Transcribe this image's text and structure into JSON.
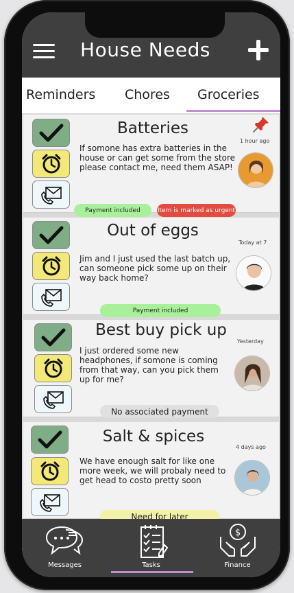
{
  "header": {
    "title": "House Needs"
  },
  "tabs": [
    {
      "label": "Reminders"
    },
    {
      "label": "Chores"
    },
    {
      "label": "Groceries",
      "active": true
    }
  ],
  "cards": [
    {
      "title": "Batteries",
      "description": "If somone has extra batteries in the house or can get some from the store please contact me, need them ASAP!",
      "time": "1 hour ago",
      "pinned": true,
      "tags": [
        "Payment included",
        "Item is marked as urgent"
      ]
    },
    {
      "title": "Out of eggs",
      "description": "Jim and I just used the last batch up, can someone pick some up on their way back home?",
      "time": "Today at 7",
      "tags": [
        "Payment included"
      ]
    },
    {
      "title": "Best buy pick up",
      "description": "I just ordered some new headphones, if somone is coming from that way, can you pick them up for me?",
      "time": "Yesterday",
      "tags": [
        "No associated payment"
      ]
    },
    {
      "title": "Salt & spices",
      "description": "We have enough salt for like one more week, we will probaly need to get head to costo pretty soon",
      "time": "4 days ago",
      "tags": [
        "Need for later"
      ]
    }
  ],
  "bottom_nav": [
    {
      "label": "Messages",
      "icon": "chat-bubbles-icon"
    },
    {
      "label": "Tasks",
      "icon": "checklist-icon",
      "active": true
    },
    {
      "label": "Finance",
      "icon": "money-hands-icon"
    }
  ],
  "colors": {
    "header": "#3f3f3f",
    "accent": "#c58cd6",
    "check_button": "#7fae86",
    "alarm_button": "#f3e978",
    "message_button": "#eef7fb",
    "tag_green": "#a9f09a",
    "tag_red": "#e24b3f"
  }
}
